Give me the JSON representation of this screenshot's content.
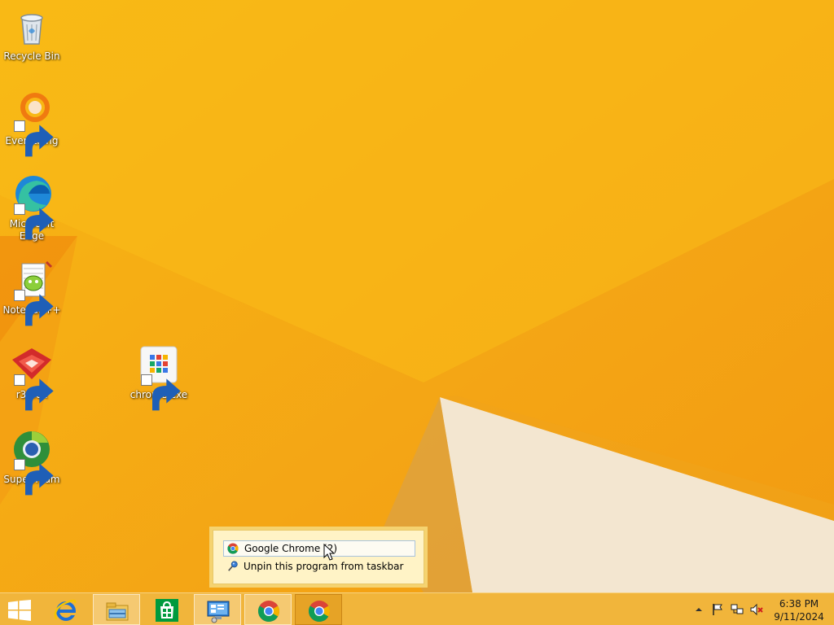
{
  "desktop": {
    "icons": [
      {
        "label": "Recycle Bin",
        "icon": "recycle-bin-icon"
      },
      {
        "label": "Everything",
        "icon": "everything-icon"
      },
      {
        "label": "Microsoft Edge",
        "icon": "edge-icon"
      },
      {
        "label": "Notepad++",
        "icon": "notepad-plus-plus-icon"
      },
      {
        "label": "r3dfox",
        "icon": "r3dfox-icon"
      },
      {
        "label": "Supermium",
        "icon": "supermium-icon"
      },
      {
        "label": "chrome.exe",
        "icon": "chrome-exe-icon"
      }
    ]
  },
  "jumplist": {
    "title_item": "Google Chrome (2)",
    "unpin_item": "Unpin this program from taskbar"
  },
  "taskbar": {
    "buttons": [
      "start-icon",
      "internet-explorer-icon",
      "file-explorer-icon",
      "store-icon",
      "control-panel-icon",
      "chrome-icon",
      "chrome-icon"
    ],
    "clock": {
      "time": "6:38 PM",
      "date": "9/11/2024"
    }
  },
  "colors": {
    "wallpaper": "#f5b21a",
    "taskbar": "#f1b53b",
    "jumplist_bg": "#fff3c6"
  }
}
